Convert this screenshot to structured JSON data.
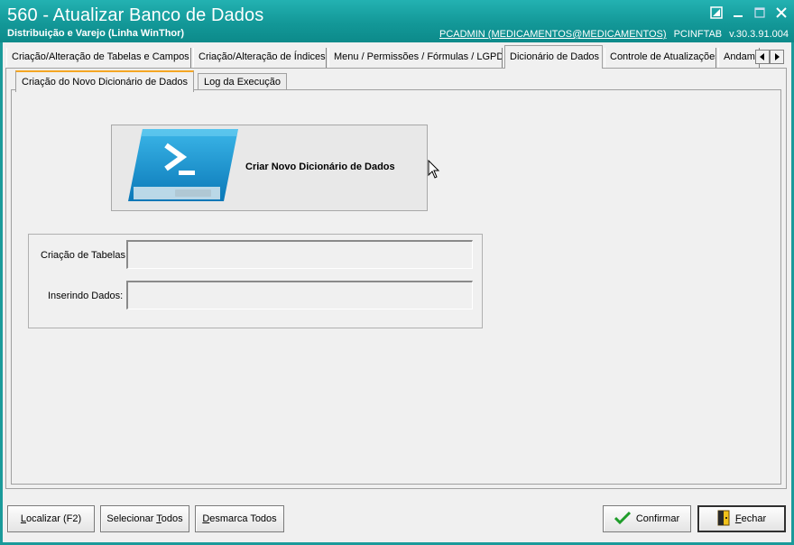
{
  "window": {
    "title": "560 - Atualizar Banco de Dados",
    "subtitle": "Distribuição e Varejo (Linha WinThor)",
    "user": "PCADMIN (MEDICAMENTOS@MEDICAMENTOS)",
    "table": "PCINFTAB",
    "version": "v.30.3.91.004"
  },
  "tabs": [
    {
      "label": "Criação/Alteração de Tabelas e Campos"
    },
    {
      "label": "Criação/Alteração de Índices"
    },
    {
      "label": "Menu / Permissões / Fórmulas / LGPD"
    },
    {
      "label": "Dicionário de Dados",
      "active": true
    },
    {
      "label": "Controle de Atualizações"
    },
    {
      "label": "Andame"
    }
  ],
  "subtabs": [
    {
      "label": "Criação do Novo Dicionário de Dados",
      "active": true
    },
    {
      "label": "Log da Execução"
    }
  ],
  "create_button": {
    "label": "Criar Novo Dicionário de Dados"
  },
  "progress": {
    "tables_label": "Criação de Tabelas",
    "tables_value": "",
    "insert_label": "Inserindo Dados:",
    "insert_value": ""
  },
  "buttons": {
    "localizar_pre": "",
    "localizar_u": "L",
    "localizar_post": "ocalizar (F2)",
    "selecionar_pre": "Selecionar ",
    "selecionar_u": "T",
    "selecionar_post": "odos",
    "desmarca_pre": "",
    "desmarca_u": "D",
    "desmarca_post": "esmarca Todos",
    "confirmar": "Confirmar",
    "fechar_u": "F",
    "fechar_post": "echar"
  },
  "colors": {
    "titlebar": "#139898",
    "accent_tab": "#f5a623",
    "confirm_check": "#1f9d2a"
  }
}
